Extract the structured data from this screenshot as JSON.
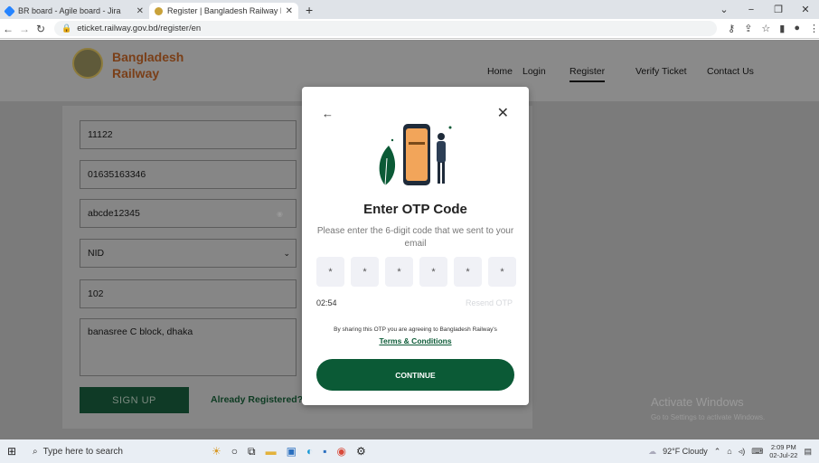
{
  "browser": {
    "tabs": [
      {
        "title": "BR board - Agile board - Jira",
        "active": false
      },
      {
        "title": "Register | Bangladesh Railway E-",
        "active": true
      }
    ],
    "new_tab": "+",
    "url": "eticket.railway.gov.bd/register/en"
  },
  "site": {
    "brand_line1": "Bangladesh",
    "brand_line2": "Railway",
    "nav": [
      "Home",
      "Login",
      "Register",
      "Verify Ticket",
      "Contact Us"
    ],
    "nav_active": "Register"
  },
  "form": {
    "fields": [
      "11122",
      "01635163346",
      "abcde12345",
      "NID",
      "102",
      "banasree C block, dhaka"
    ],
    "signup_label": "SIGN UP",
    "already_label": "Already Registered?"
  },
  "modal": {
    "title": "Enter OTP Code",
    "subtitle": "Please enter the 6-digit code that we sent to your email",
    "otp": [
      "*",
      "*",
      "*",
      "*",
      "*",
      "*"
    ],
    "timer": "02:54",
    "resend": "Resend OTP",
    "agree_text": "By sharing this OTP you are agreeing to Bangladesh Railway's",
    "terms": "Terms & Conditions",
    "continue_label": "CONTINUE"
  },
  "watermark": {
    "line1": "Activate Windows",
    "line2": "Go to Settings to activate Windows."
  },
  "taskbar": {
    "search_placeholder": "Type here to search",
    "weather": "92°F  Cloudy",
    "time": "2:09 PM",
    "date": "02-Jul-22"
  },
  "colors": {
    "accent": "#0b5a36",
    "brand": "#7a3f18"
  }
}
